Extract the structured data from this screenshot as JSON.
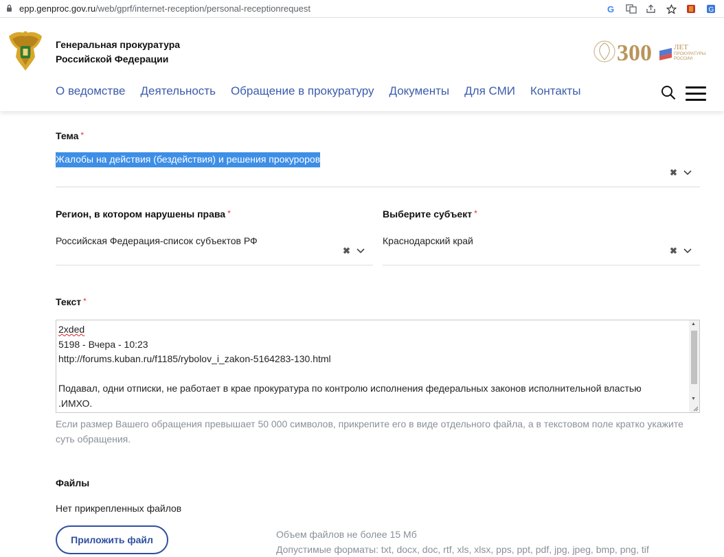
{
  "browser": {
    "url_domain": "epp.genproc.gov.ru",
    "url_path": "/web/gprf/internet-reception/personal-receptionrequest",
    "icons": [
      "lock-icon",
      "google-icon",
      "translate-icon",
      "share-icon",
      "star-icon",
      "extension-icon",
      "translator-extension-icon"
    ]
  },
  "header": {
    "org_line1": "Генеральная прокуратура",
    "org_line2": "Российской Федерации",
    "anniversary_number": "300",
    "anniversary_word": "ЛЕТ",
    "anniversary_sub1": "ПРОКУРАТУРЫ",
    "anniversary_sub2": "РОССИИ",
    "nav": [
      "О ведомстве",
      "Деятельность",
      "Обращение в прокуратуру",
      "Документы",
      "Для СМИ",
      "Контакты"
    ]
  },
  "form": {
    "topic_label": "Тема",
    "topic_value": "Жалобы на действия (бездействия) и решения прокуроров",
    "region_label": "Регион, в котором нарушены права",
    "region_value": "Российская Федерация-список субъектов РФ",
    "subject_label": "Выберите субъект",
    "subject_value": "Краснодарский край",
    "text_label": "Текст",
    "text_lines": [
      "2xded",
      "5198 - Вчера - 10:23",
      "http://forums.kuban.ru/f1185/rybolov_i_zakon-5164283-130.html",
      "",
      "Подавал, одни отписки, не работает в крае прокуратура по контролю исполнения федеральных законов исполнительной властью",
      ".ИМХО."
    ],
    "hint": "Если размер Вашего обращения превышает 50 000 символов, прикрепите его в виде отдельного файла, а в текстовом поле кратко укажите суть обращения.",
    "required_mark": "*",
    "clear_symbol": "✖"
  },
  "files": {
    "title": "Файлы",
    "empty": "Нет прикрепленных файлов",
    "attach_button": "Приложить файл",
    "size_limit": "Объем файлов не более 15 Мб",
    "formats": "Допустимые форматы: txt, docx, doc, rtf, xls, xlsx, pps, ppt, pdf, jpg, jpeg, bmp, png, tif"
  },
  "colors": {
    "nav_link": "#3b5cad",
    "selection": "#3d8ee6",
    "button_border": "#2f4e9e",
    "required": "#dd3333",
    "hint": "#8a8f98"
  }
}
